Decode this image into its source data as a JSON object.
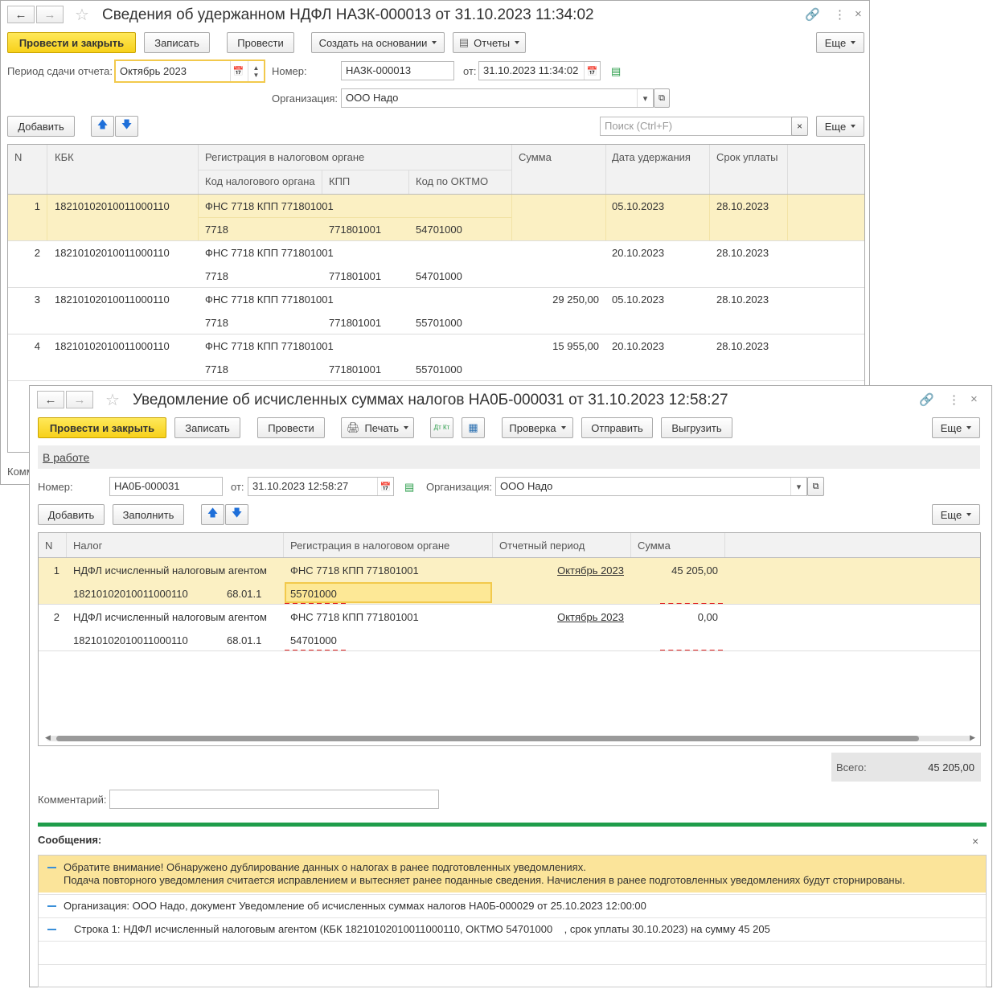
{
  "w1": {
    "title": "Сведения об удержанном НДФЛ НАЗК-000013 от 31.10.2023 11:34:02",
    "toolbar": {
      "post_close": "Провести и закрыть",
      "save": "Записать",
      "post": "Провести",
      "create_based": "Создать на основании",
      "reports": "Отчеты",
      "more": "Еще"
    },
    "period_label": "Период сдачи отчета:",
    "period_value": "Октябрь 2023",
    "number_label": "Номер:",
    "number_value": "НАЗК-000013",
    "date_label": "от:",
    "date_value": "31.10.2023 11:34:02",
    "org_label": "Организация:",
    "org_value": "ООО Надо",
    "add": "Добавить",
    "search_placeholder": "Поиск (Ctrl+F)",
    "more2": "Еще",
    "comment_label": "Комм",
    "headers": {
      "n": "N",
      "kbk": "КБК",
      "reg": "Регистрация в налоговом органе",
      "code": "Код налогового органа",
      "kpp": "КПП",
      "oktmo": "Код по ОКТМО",
      "sum": "Сумма",
      "date": "Дата удержания",
      "due": "Срок уплаты"
    },
    "rows": [
      {
        "n": "1",
        "kbk": "18210102010011000110",
        "reg": "ФНС 7718 КПП 771801001",
        "code": "7718",
        "kpp": "771801001",
        "oktmo": "54701000",
        "sum": "",
        "date": "05.10.2023",
        "due": "28.10.2023"
      },
      {
        "n": "2",
        "kbk": "18210102010011000110",
        "reg": "ФНС 7718 КПП 771801001",
        "code": "7718",
        "kpp": "771801001",
        "oktmo": "54701000",
        "sum": "",
        "date": "20.10.2023",
        "due": "28.10.2023"
      },
      {
        "n": "3",
        "kbk": "18210102010011000110",
        "reg": "ФНС 7718 КПП 771801001",
        "code": "7718",
        "kpp": "771801001",
        "oktmo": "55701000",
        "sum": "29 250,00",
        "date": "05.10.2023",
        "due": "28.10.2023"
      },
      {
        "n": "4",
        "kbk": "18210102010011000110",
        "reg": "ФНС 7718 КПП 771801001",
        "code": "7718",
        "kpp": "771801001",
        "oktmo": "55701000",
        "sum": "15 955,00",
        "date": "20.10.2023",
        "due": "28.10.2023"
      }
    ]
  },
  "w2": {
    "title": "Уведомление об исчисленных суммах налогов НА0Б-000031 от 31.10.2023 12:58:27",
    "toolbar": {
      "post_close": "Провести и закрыть",
      "save": "Записать",
      "post": "Провести",
      "print": "Печать",
      "check": "Проверка",
      "send": "Отправить",
      "export": "Выгрузить",
      "more": "Еще",
      "dtkt": "Дт Кт"
    },
    "status_link": "В работе",
    "number_label": "Номер:",
    "number_value": "НА0Б-000031",
    "date_label": "от:",
    "date_value": "31.10.2023 12:58:27",
    "org_label": "Организация:",
    "org_value": "ООО Надо",
    "add": "Добавить",
    "fill": "Заполнить",
    "more2": "Еще",
    "headers": {
      "n": "N",
      "tax": "Налог",
      "reg": "Регистрация в налоговом органе",
      "period": "Отчетный период",
      "sum": "Сумма"
    },
    "rows": [
      {
        "n": "1",
        "tax": "НДФЛ исчисленный налоговым агентом",
        "kbk": "18210102010011000110",
        "account": "68.01.1",
        "reg": "ФНС 7718 КПП 771801001",
        "oktmo": "55701000",
        "period": "Октябрь 2023",
        "sum": "45 205,00"
      },
      {
        "n": "2",
        "tax": "НДФЛ исчисленный налоговым агентом",
        "kbk": "18210102010011000110",
        "account": "68.01.1",
        "reg": "ФНС 7718 КПП 771801001",
        "oktmo": "54701000",
        "period": "Октябрь 2023",
        "sum": "0,00"
      }
    ],
    "total_label": "Всего:",
    "total_value": "45 205,00",
    "comment_label": "Комментарий:",
    "messages_title": "Сообщения:",
    "messages": [
      {
        "line1": "Обратите внимание! Обнаружено дублирование данных о налогах в ранее подготовленных уведомлениях.",
        "line2": "Подача повторного уведомления считается исправлением и вытесняет ранее поданные сведения. Начисления в ранее подготовленных уведомлениях будут сторнированы."
      },
      {
        "line1": "Организация: ООО Надо, документ Уведомление об исчисленных суммах налогов НА0Б-000029 от 25.10.2023 12:00:00"
      },
      {
        "line1": "Строка 1: НДФЛ исчисленный налоговым агентом (КБК 18210102010011000110, ОКТМО 54701000    , срок уплаты 30.10.2023) на сумму 45 205"
      }
    ]
  }
}
